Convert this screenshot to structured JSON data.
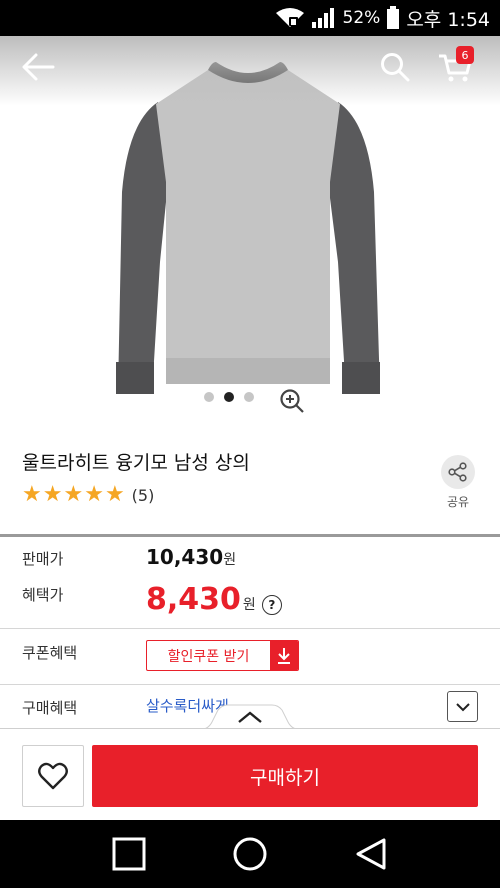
{
  "status_bar": {
    "battery": "52%",
    "time": "오후 1:54"
  },
  "header": {
    "cart_count": "6"
  },
  "product": {
    "title": "울트라히트 융기모 남성 상의",
    "rating_stars": 5,
    "review_count": "(5)",
    "share_label": "공유",
    "image_page": 2,
    "image_pages": 3
  },
  "pricing": {
    "sale_label": "판매가",
    "sale_price": "10,430",
    "sale_unit": "원",
    "benefit_label": "혜택가",
    "benefit_price": "8,430",
    "benefit_unit": "원",
    "help": "?"
  },
  "coupon": {
    "label": "쿠폰혜택",
    "button": "할인쿠폰 받기"
  },
  "purchase_benefit": {
    "label": "구매혜택",
    "link": "살수록더싸게"
  },
  "actions": {
    "buy_label": "구매하기"
  },
  "colors": {
    "accent": "#e8202a",
    "link": "#2a5cc8",
    "star": "#f5a623"
  }
}
